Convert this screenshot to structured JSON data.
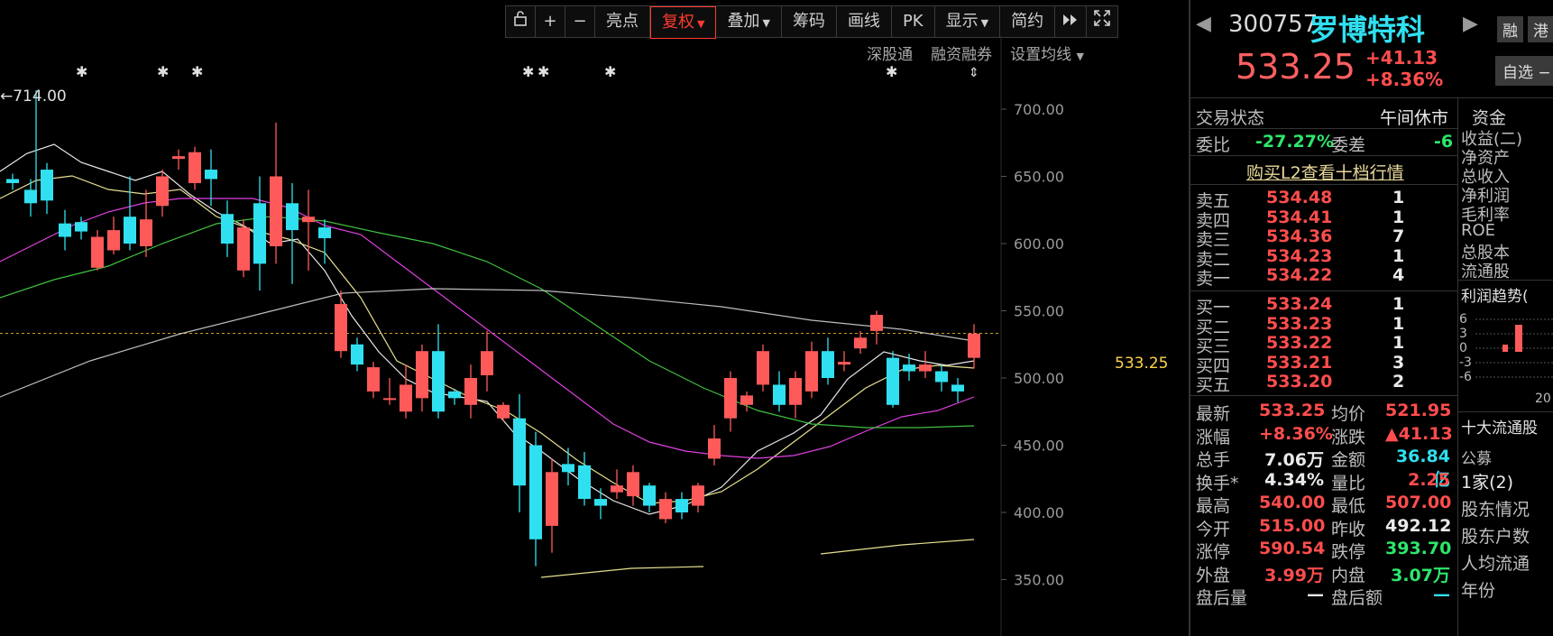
{
  "toolbar": {
    "items": [
      "亮点",
      "复权",
      "叠加",
      "筹码",
      "画线",
      "PK",
      "显示",
      "简约"
    ],
    "lock_icon": "lock-icon",
    "plus_label": "+",
    "minus_label": "−"
  },
  "subbar": [
    "深股通",
    "融资融券",
    "设置均线"
  ],
  "chart": {
    "y_ticks": [
      "700.00",
      "650.00",
      "600.00",
      "550.00",
      "500.00",
      "450.00",
      "400.00",
      "350.00"
    ],
    "price_line_label": "533.25",
    "high_marker": "←714.00",
    "star_glyph": "✱"
  },
  "header": {
    "code": "300757",
    "name": "罗博特科",
    "price": "533.25",
    "change": "+41.13",
    "change_pct": "+8.36%",
    "badge1": "融",
    "badge2": "港",
    "watch_btn": "自选 −"
  },
  "status": {
    "label": "交易状态",
    "value": "午间休市",
    "weibi_label": "委比",
    "weibi_value": "-27.27%",
    "weicha_label": "委差",
    "weicha_value": "-6",
    "l2_link": "购买L2查看十档行情"
  },
  "asks": [
    {
      "label": "卖五",
      "price": "534.48",
      "vol": "1"
    },
    {
      "label": "卖四",
      "price": "534.41",
      "vol": "1"
    },
    {
      "label": "卖三",
      "price": "534.36",
      "vol": "7"
    },
    {
      "label": "卖二",
      "price": "534.23",
      "vol": "1"
    },
    {
      "label": "卖一",
      "price": "534.22",
      "vol": "4"
    }
  ],
  "bids": [
    {
      "label": "买一",
      "price": "533.24",
      "vol": "1"
    },
    {
      "label": "买二",
      "price": "533.23",
      "vol": "1"
    },
    {
      "label": "买三",
      "price": "533.22",
      "vol": "1"
    },
    {
      "label": "买四",
      "price": "533.21",
      "vol": "3"
    },
    {
      "label": "买五",
      "price": "533.20",
      "vol": "2"
    }
  ],
  "stats": [
    {
      "l1": "最新",
      "v1": "533.25",
      "c1": "red",
      "l2": "均价",
      "v2": "521.95",
      "c2": "red"
    },
    {
      "l1": "涨幅",
      "v1": "+8.36%",
      "c1": "red",
      "l2": "涨跌",
      "v2": "▲41.13",
      "c2": "red"
    },
    {
      "l1": "总手",
      "v1": "7.06万",
      "c1": "white",
      "l2": "金额",
      "v2": "36.84亿",
      "c2": "cyan"
    },
    {
      "l1": "换手*",
      "v1": "4.34%",
      "c1": "white",
      "l2": "量比",
      "v2": "2.25",
      "c2": "red"
    },
    {
      "l1": "最高",
      "v1": "540.00",
      "c1": "red",
      "l2": "最低",
      "v2": "507.00",
      "c2": "red"
    },
    {
      "l1": "今开",
      "v1": "515.00",
      "c1": "red",
      "l2": "昨收",
      "v2": "492.12",
      "c2": "white"
    },
    {
      "l1": "涨停",
      "v1": "590.54",
      "c1": "red",
      "l2": "跌停",
      "v2": "393.70",
      "c2": "green"
    },
    {
      "l1": "外盘",
      "v1": "3.99万",
      "c1": "red",
      "l2": "内盘",
      "v2": "3.07万",
      "c2": "green"
    },
    {
      "l1": "盘后量",
      "v1": "—",
      "c1": "white",
      "l2": "盘后额",
      "v2": "—",
      "c2": "cyan"
    }
  ],
  "side": {
    "tab": "资金",
    "items": [
      "收益(二)",
      "净资产",
      "总收入",
      "净利润",
      "毛利率",
      "ROE",
      "总股本",
      "流通股"
    ],
    "profit_title": "利润趋势(",
    "profit_ticks": [
      "6",
      "3",
      "0",
      "-3",
      "-6"
    ],
    "profit_year": "20",
    "top10": "十大流通股",
    "fund_label": "公募",
    "fund_value": "1家(2)",
    "holder_info": "股东情况",
    "holder_count": "股东户数",
    "avg_float": "人均流通",
    "year_label": "年份"
  }
}
